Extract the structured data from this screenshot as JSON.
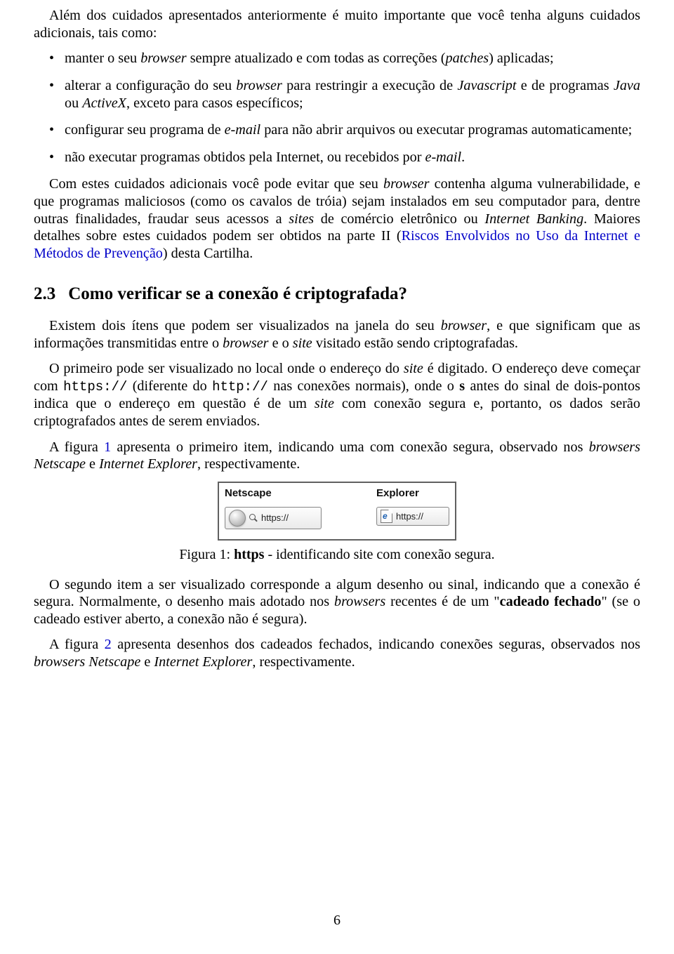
{
  "intro": {
    "p1_a": "Além dos cuidados apresentados anteriormente é muito importante que você tenha alguns cuidados adicionais, tais como:"
  },
  "bullets": [
    {
      "pre": "manter o seu ",
      "i1": "browser",
      "post": " sempre atualizado e com todas as correções (",
      "i2": "patches",
      "post2": ") aplicadas;"
    },
    {
      "pre": "alterar a configuração do seu ",
      "i1": "browser",
      "mid": " para restringir a execução de ",
      "i2": "Javascript",
      "mid2": " e de programas ",
      "i3": "Java",
      "mid3": " ou ",
      "i4": "ActiveX",
      "post": ", exceto para casos específicos;"
    },
    {
      "pre": "configurar seu programa de ",
      "i1": "e-mail",
      "post": " para não abrir arquivos ou executar programas automaticamente;"
    },
    {
      "pre": "não executar programas obtidos pela Internet, ou recebidos por ",
      "i1": "e-mail",
      "post": "."
    }
  ],
  "para2": {
    "a": "Com estes cuidados adicionais você pode evitar que seu ",
    "i_browser": "browser",
    "b": " contenha alguma vulnerabilidade, e que programas maliciosos (como os cavalos de tróia) sejam instalados em seu computador para, dentre outras finalidades, fraudar seus acessos a ",
    "i_sites": "sites",
    "c": " de comércio eletrônico ou ",
    "i_banking": "Internet Banking",
    "d": ". Maiores detalhes sobre estes cuidados podem ser obtidos na parte II (",
    "link": "Riscos Envolvidos no Uso da Internet e Métodos de Prevenção",
    "e": ") desta Cartilha."
  },
  "section": {
    "num": "2.3",
    "title": "Como verificar se a conexão é criptografada?"
  },
  "s23_p1": {
    "a": "Existem dois ítens que podem ser visualizados na janela do seu ",
    "i_browser": "browser",
    "b": ", e que significam que as informações transmitidas entre o ",
    "i_browser2": "browser",
    "c": " e o ",
    "i_site": "site",
    "d": " visitado estão sendo criptografadas."
  },
  "s23_p2": {
    "a": "O primeiro pode ser visualizado no local onde o endereço do ",
    "i_site": "site",
    "b": " é digitado. O endereço deve começar com ",
    "code_https": "https://",
    "c": " (diferente do ",
    "code_http": "http://",
    "d": " nas conexões normais), onde o ",
    "bold_s": "s",
    "e": " antes do sinal de dois-pontos indica que o endereço em questão é de um ",
    "i_site2": "site",
    "f": " com conexão segura e, portanto, os dados serão criptografados antes de serem enviados."
  },
  "s23_p3": {
    "a": "A figura ",
    "link": "1",
    "b": " apresenta o primeiro item, indicando uma com conexão segura, observado nos ",
    "i_browsers": "browsers Netscape",
    "c": " e ",
    "i_ie": "Internet Explorer",
    "d": ", respectivamente."
  },
  "figure": {
    "netscape_label": "Netscape",
    "explorer_label": "Explorer",
    "netscape_url": "https://",
    "explorer_url": "https://",
    "caption_pre": "Figura 1: ",
    "caption_bold": "https",
    "caption_post": " - identificando site com conexão segura."
  },
  "s23_p4": {
    "a": "O segundo item a ser visualizado corresponde a algum desenho ou sinal, indicando que a conexão é segura. Normalmente, o desenho mais adotado nos ",
    "i_browsers": "browsers",
    "b": " recentes é de um \"",
    "bold_lock": "cadeado fechado",
    "c": "\" (se o cadeado estiver aberto, a conexão não é segura)."
  },
  "s23_p5": {
    "a": "A figura ",
    "link": "2",
    "b": " apresenta desenhos dos cadeados fechados, indicando conexões seguras, observados nos ",
    "i_browsers": "browsers Netscape",
    "c": " e ",
    "i_ie": "Internet Explorer",
    "d": ", respectivamente."
  },
  "page_number": "6"
}
